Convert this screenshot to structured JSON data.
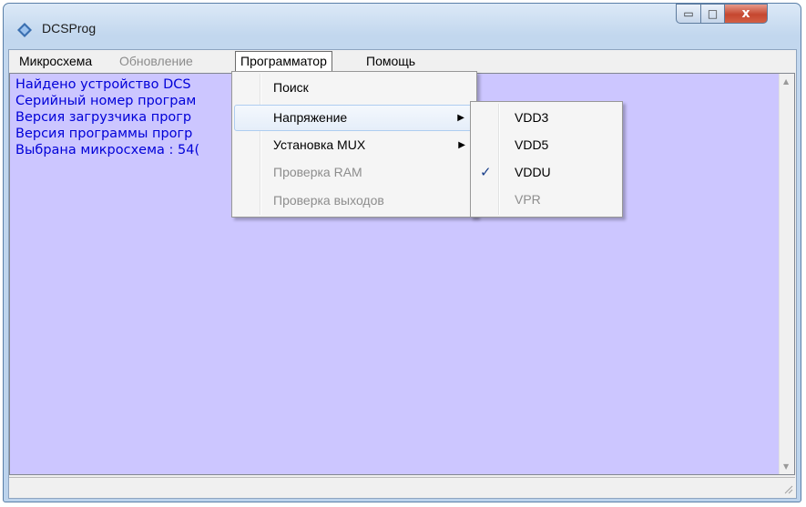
{
  "window": {
    "title": "DCSProg",
    "close_glyph": "x",
    "minimize_glyph": "▭",
    "maximize_glyph": "□"
  },
  "menubar": {
    "items": [
      {
        "label": "Микросхема",
        "disabled": false
      },
      {
        "label": "Обновление",
        "disabled": true
      },
      {
        "label": "Программатор",
        "disabled": false,
        "open": true
      },
      {
        "label": "Помощь",
        "disabled": false
      }
    ]
  },
  "log": {
    "lines": [
      "Найдено устройство DCS",
      "Серийный номер програм",
      "Версия загрузчика прогр",
      "Версия программы прогр",
      "Выбрана микросхема : 54("
    ],
    "background": "#ccc6ff",
    "text_color": "#0000d8"
  },
  "programmer_menu": {
    "items": [
      {
        "label": "Поиск",
        "disabled": false,
        "submenu": false
      },
      {
        "label": "Напряжение",
        "disabled": false,
        "submenu": true,
        "highlighted": true
      },
      {
        "label": "Установка MUX",
        "disabled": false,
        "submenu": true
      },
      {
        "label": "Проверка RAM",
        "disabled": true,
        "submenu": false
      },
      {
        "label": "Проверка выходов",
        "disabled": true,
        "submenu": false
      }
    ]
  },
  "voltage_submenu": {
    "items": [
      {
        "label": "VDD3",
        "disabled": false,
        "checked": false
      },
      {
        "label": "VDD5",
        "disabled": false,
        "checked": false
      },
      {
        "label": "VDDU",
        "disabled": false,
        "checked": true
      },
      {
        "label": "VPR",
        "disabled": true,
        "checked": false
      }
    ],
    "check_glyph": "✓"
  },
  "submenu_arrow": "▶",
  "scroll_up": "▲",
  "scroll_down": "▼",
  "icons": [
    "app-diamond-icon",
    "minimize-icon",
    "maximize-icon",
    "close-icon",
    "chevron-right-icon",
    "checkmark-icon",
    "scroll-up-arrow-icon",
    "scroll-down-arrow-icon",
    "resize-grip-icon"
  ]
}
